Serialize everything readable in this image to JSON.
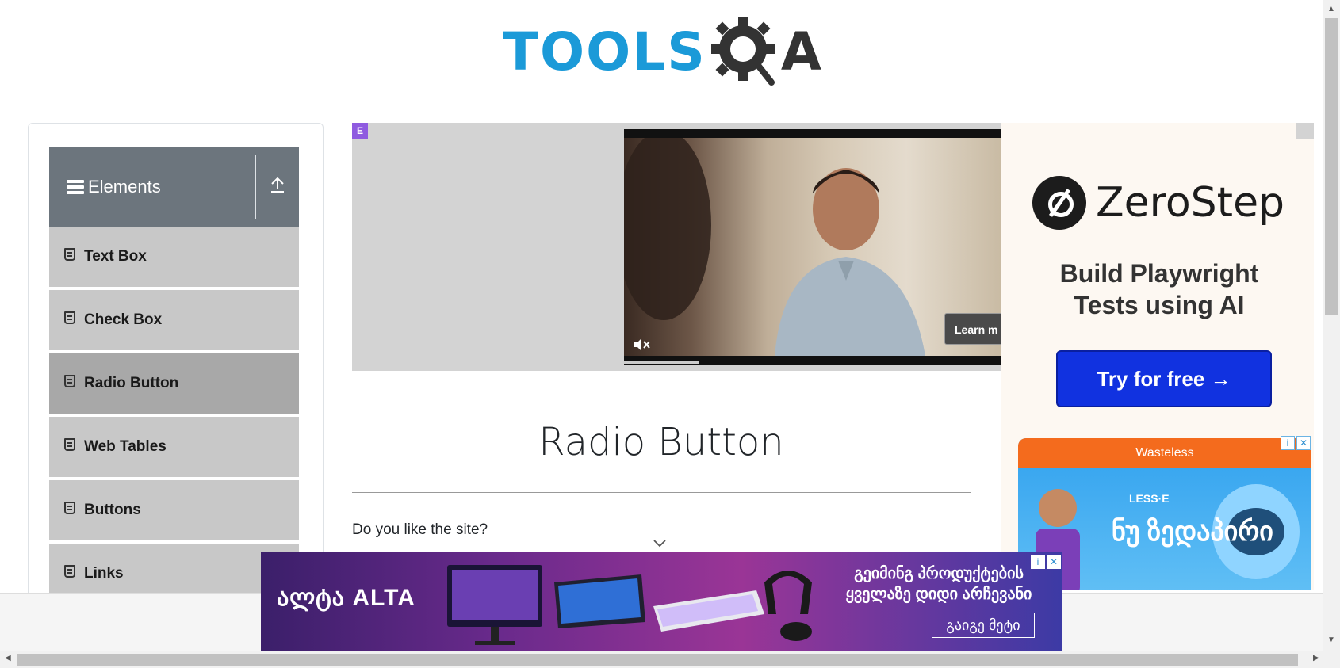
{
  "header": {
    "logo_text": "TOOLS",
    "logo_suffix": "A"
  },
  "sidebar": {
    "group_title": "Elements",
    "items": [
      {
        "label": "Text Box"
      },
      {
        "label": "Check Box"
      },
      {
        "label": "Radio Button",
        "active": true
      },
      {
        "label": "Web Tables"
      },
      {
        "label": "Buttons"
      },
      {
        "label": "Links"
      }
    ]
  },
  "video_ad": {
    "badge": "E",
    "cta": "Learn m"
  },
  "right_ad": {
    "brand": "ZeroStep",
    "tagline": "Build Playwright Tests using AI",
    "cta": "Try for free →",
    "secondary_brand": "Wasteless",
    "secondary_tag": "LESS·E",
    "secondary_text": "ნუ ზედაპირი",
    "adchoice_info": "i",
    "adchoice_close": "✕"
  },
  "main": {
    "title": "Radio Button",
    "question": "Do you like the site?"
  },
  "bottom_ad": {
    "brand": "ALTA",
    "brand_prefix": "ალტა",
    "headline": "გეიმინგ პროდუქტების ყველაზე დიდი არჩევანი",
    "cta": "გაიგე მეტი",
    "adchoice_info": "i",
    "adchoice_close": "✕"
  },
  "colors": {
    "logo_blue": "#1b9ad8",
    "sidebar_header": "#6c757d",
    "menu_item": "#c8c8c8",
    "menu_item_active": "#a8a8a8",
    "cta_blue": "#1132e0"
  }
}
